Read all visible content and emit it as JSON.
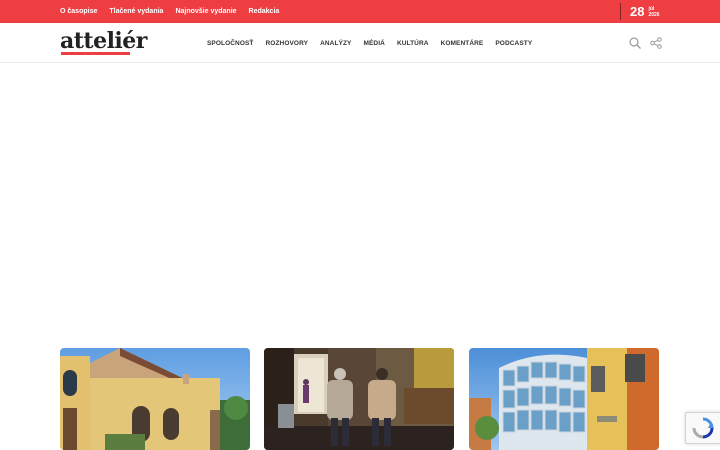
{
  "topbar": {
    "links": [
      "O časopise",
      "Tlačené vydania",
      "Najnovšie vydanie",
      "Redakcia"
    ],
    "date": {
      "day": "28",
      "month": "júl",
      "year": "2026"
    },
    "bg_color": "#ef3e42"
  },
  "header": {
    "logo": "atteliér",
    "nav": [
      "SPOLOČNOSŤ",
      "ROZHOVORY",
      "ANALÝZY",
      "MÉDIÁ",
      "KULTÚRA",
      "KOMENTÁRE",
      "PODCASTY"
    ],
    "icons": [
      "search-icon",
      "share-icon"
    ]
  },
  "cards": [
    {
      "image": "church-building-photo"
    },
    {
      "image": "elderly-people-interior-photo"
    },
    {
      "image": "glass-building-photo"
    }
  ],
  "recaptcha": {
    "icon": "recaptcha-icon"
  }
}
